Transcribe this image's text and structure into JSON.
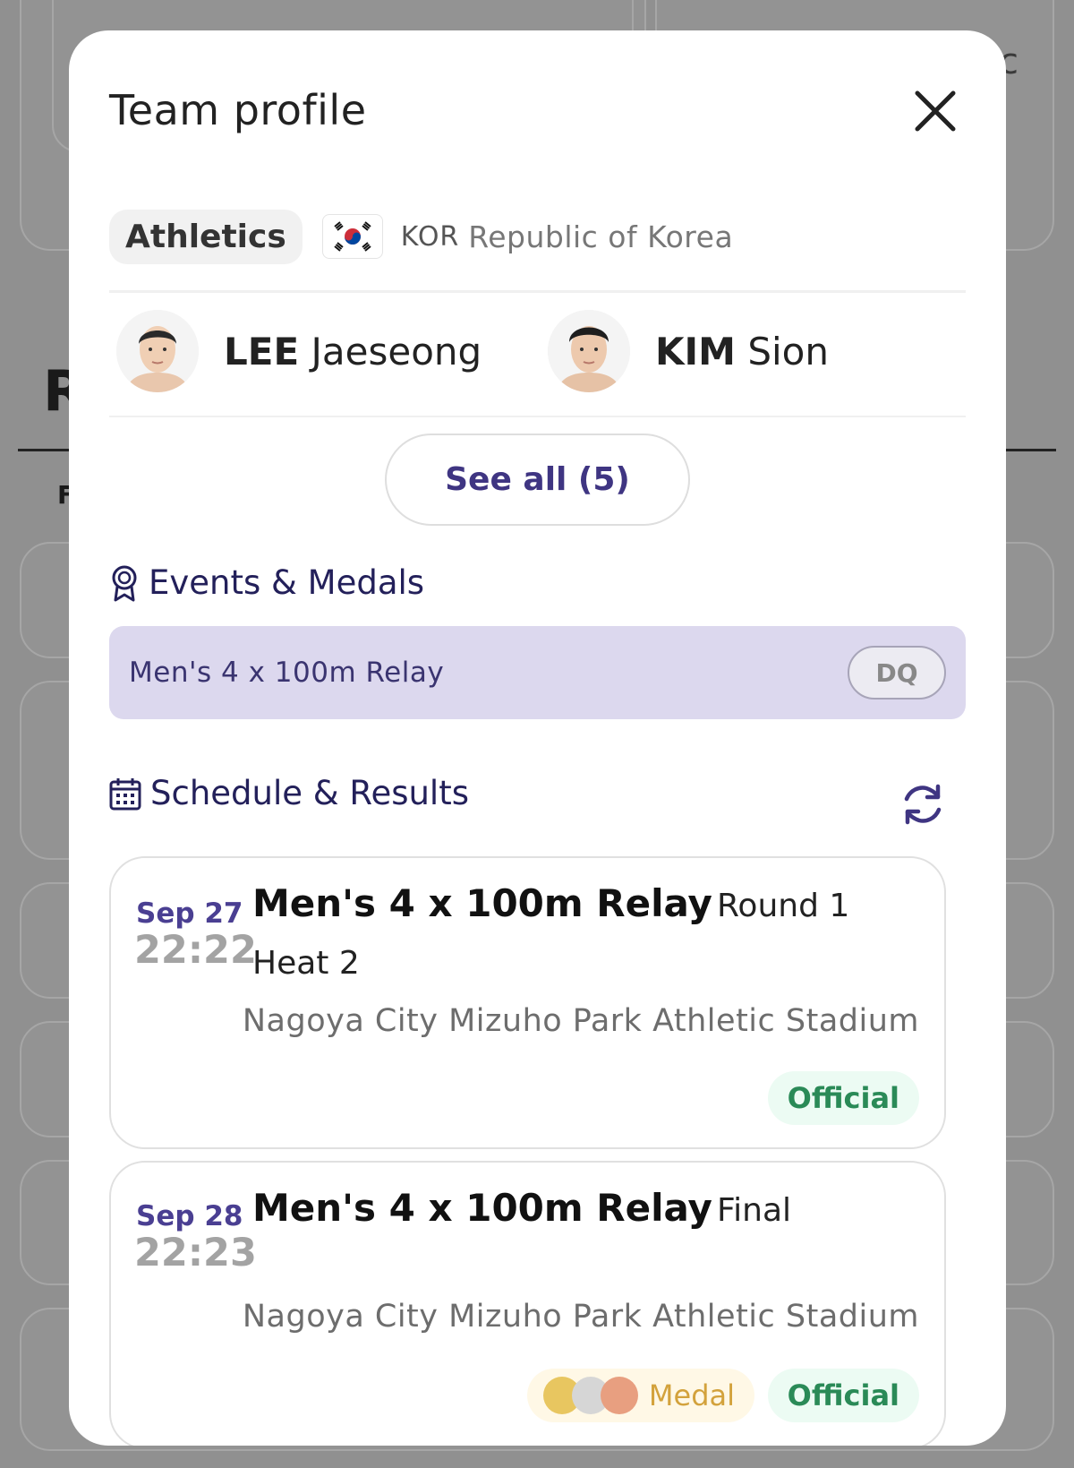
{
  "modal": {
    "title": "Team profile",
    "sport": "Athletics",
    "noc_code": "KOR",
    "country": "Republic of Korea",
    "athletes": [
      {
        "surname": "LEE",
        "given": "Jaeseong"
      },
      {
        "surname": "KIM",
        "given": "Sion"
      }
    ],
    "see_all": "See all (5)"
  },
  "events_medals": {
    "heading": "Events & Medals",
    "items": [
      {
        "name": "Men's 4 x 100m Relay",
        "status": "DQ"
      }
    ]
  },
  "schedule": {
    "heading": "Schedule & Results",
    "items": [
      {
        "date": "Sep 27",
        "time": "22:22",
        "event": "Men's 4 x 100m Relay",
        "phase": "Round 1",
        "sub_phase": "Heat 2",
        "venue": "Nagoya City Mizuho Park Athletic Stadium",
        "status": "Official"
      },
      {
        "date": "Sep 28",
        "time": "22:23",
        "event": "Men's 4 x 100m Relay",
        "phase": "Final",
        "venue": "Nagoya City Mizuho Park Athletic Stadium",
        "medal_label": "Medal",
        "status": "Official"
      }
    ]
  },
  "colors": {
    "accent": "#3f3582",
    "event_highlight": "#dcd8ee",
    "official_green": "#2a8a57",
    "medal_gold": "#e8c660",
    "medal_silver": "#d6d6d6",
    "medal_bronze": "#e89f80"
  },
  "icons": {
    "close": "close-icon",
    "medal": "medal-icon",
    "calendar": "calendar-icon",
    "refresh": "refresh-icon",
    "flag": "korea-flag-icon"
  }
}
